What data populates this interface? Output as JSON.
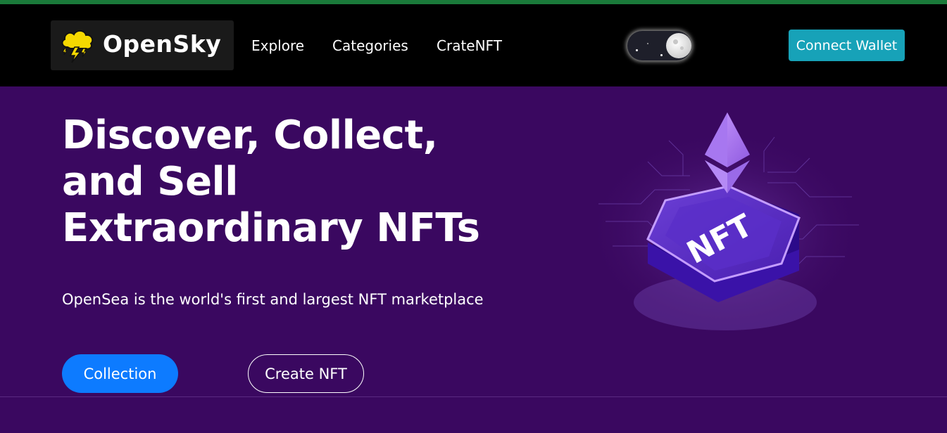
{
  "brand": {
    "name": "OpenSky",
    "icon": "storm-cloud-lightning-icon"
  },
  "nav": {
    "links": [
      {
        "label": "Explore"
      },
      {
        "label": "Categories"
      },
      {
        "label": "CrateNFT"
      }
    ],
    "theme_toggle": {
      "state": "dark",
      "icon": "moon-icon"
    },
    "connect_label": "Connect Wallet"
  },
  "hero": {
    "title": "Discover, Collect, and Sell Extraordinary NFTs",
    "subtitle": "OpenSea is the world's first and largest NFT marketplace",
    "primary_button": "Collection",
    "secondary_button": "Create NFT",
    "image": {
      "icon": "ethereum-nft-isometric-illustration",
      "badge_text": "NFT"
    }
  },
  "colors": {
    "page_bg": "#3a0860",
    "navbar_bg": "#000000",
    "top_accent": "#1a7a3a",
    "connect_bg": "#17a2b8",
    "primary_btn": "#0d7bff"
  }
}
